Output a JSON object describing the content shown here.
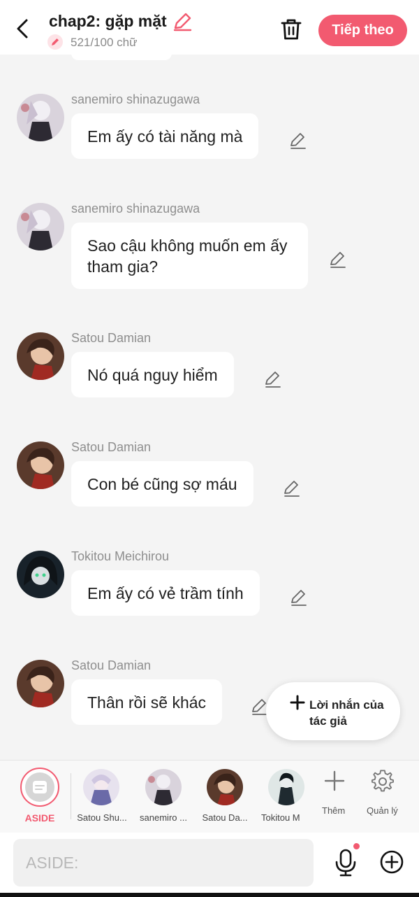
{
  "header": {
    "title": "chap2: gặp mặt",
    "word_count": "521/100 chữ",
    "next_label": "Tiếp theo"
  },
  "messages": [
    {
      "sender": "sanemiro shinazugawa",
      "text": "Em ấy có tài năng mà"
    },
    {
      "sender": "sanemiro shinazugawa",
      "text": "Sao cậu không muốn em ấy tham gia?"
    },
    {
      "sender": "Satou Damian",
      "text": "Nó quá nguy hiểm"
    },
    {
      "sender": "Satou Damian",
      "text": "Con bé cũng sợ máu"
    },
    {
      "sender": "Tokitou Meichirou",
      "text": "Em ấy có vẻ trầm tính"
    },
    {
      "sender": "Satou Damian",
      "text": "Thân rồi sẽ khác"
    }
  ],
  "author_note": {
    "label": "Lời nhắn của tác giả"
  },
  "character_bar": {
    "aside_label": "ASIDE",
    "characters": [
      {
        "name": "Satou Shu..."
      },
      {
        "name": "sanemiro ..."
      },
      {
        "name": "Satou Da..."
      },
      {
        "name": "Tokitou M"
      }
    ],
    "add_label": "Thêm",
    "manage_label": "Quản lý"
  },
  "input": {
    "placeholder": "ASIDE:"
  },
  "colors": {
    "accent": "#f25a70",
    "background": "#f4f4f4"
  }
}
